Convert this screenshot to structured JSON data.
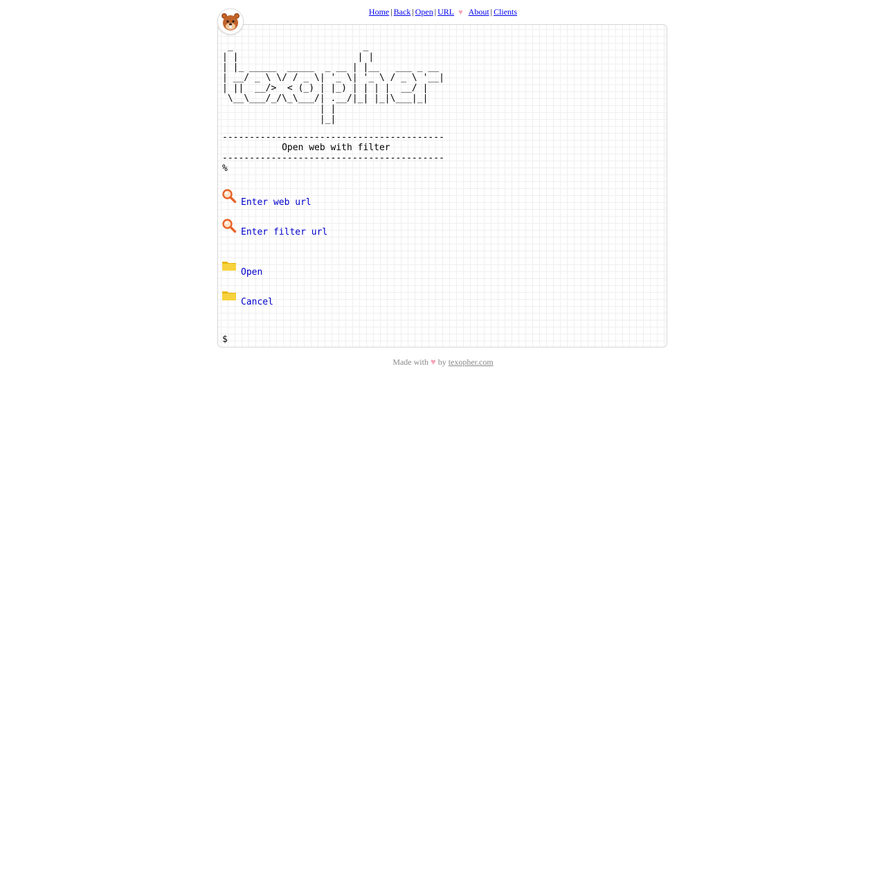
{
  "nav": {
    "home": "Home",
    "back": "Back",
    "open": "Open",
    "url": "URL",
    "heart": "♥",
    "about": "About",
    "clients": "Clients",
    "separator": "|"
  },
  "avatar": {
    "icon": "beaver-mascot-icon"
  },
  "terminal": {
    "banner": " _                        _\n| |                      | |\n| |_ _____  _____  _ __ | |__   ___ _ __\n| __/ _ \\ \\/ / _ \\| '_ \\| '_ \\ / _ \\ '__|\n| ||  __/>  < (_) | |_) | | | |  __/ |\n \\__\\___/_/\\_\\___/| .__/|_| |_|\\___|_|\n                  | |\n                  |_|",
    "rule": "-----------------------------------------",
    "heading": "           Open web with filter",
    "prompt_percent": "%",
    "items": [
      {
        "label": "Enter web url",
        "icon": "magnifier-icon"
      },
      {
        "label": "Enter filter url",
        "icon": "magnifier-icon"
      },
      {
        "label": "Open",
        "icon": "folder-icon"
      },
      {
        "label": "Cancel",
        "icon": "folder-icon"
      }
    ],
    "prompt_dollar": "$"
  },
  "footer": {
    "made_with": "Made with",
    "heart": "♥",
    "by": "by",
    "link": "texopher.com"
  },
  "colors": {
    "link": "#0000ee",
    "menu_link": "#0000cc",
    "heart": "#f5a3b5",
    "footer_text": "#888888",
    "grid": "#efefef"
  }
}
